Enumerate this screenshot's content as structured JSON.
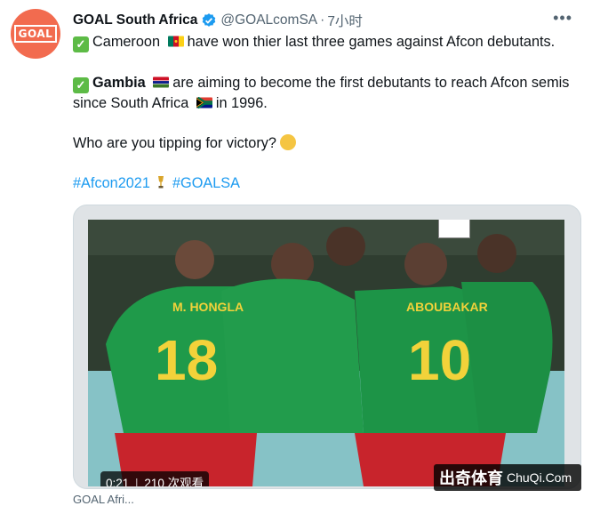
{
  "tweet": {
    "author_name": "GOAL South Africa",
    "handle": "@GOALcomSA",
    "separator": "·",
    "time": "7小时",
    "avatar_logo_text": "GOAL",
    "more_icon": "more-icon",
    "lines": {
      "line1": "Cameroon",
      "line1_rest": "have won thier last three games against Afcon debutants.",
      "line2_bold": "Gambia",
      "line2_rest": "are aiming to become the first debutants to reach Afcon semis  since South Africa",
      "line2_end": "in 1996.",
      "line3": "Who are you tipping for victory?"
    },
    "hashtags": [
      "#Afcon2021",
      "#GOALSA"
    ]
  },
  "media": {
    "duration": "0:21",
    "views": "210 次观看",
    "player_names": [
      "M. HONGLA",
      "ABOUBAKAR"
    ],
    "player_numbers": [
      "18",
      "10"
    ]
  },
  "watermark": {
    "main": "出奇体育",
    "site": "ChuQi.Com"
  },
  "next_row": "GOAL Afri..."
}
